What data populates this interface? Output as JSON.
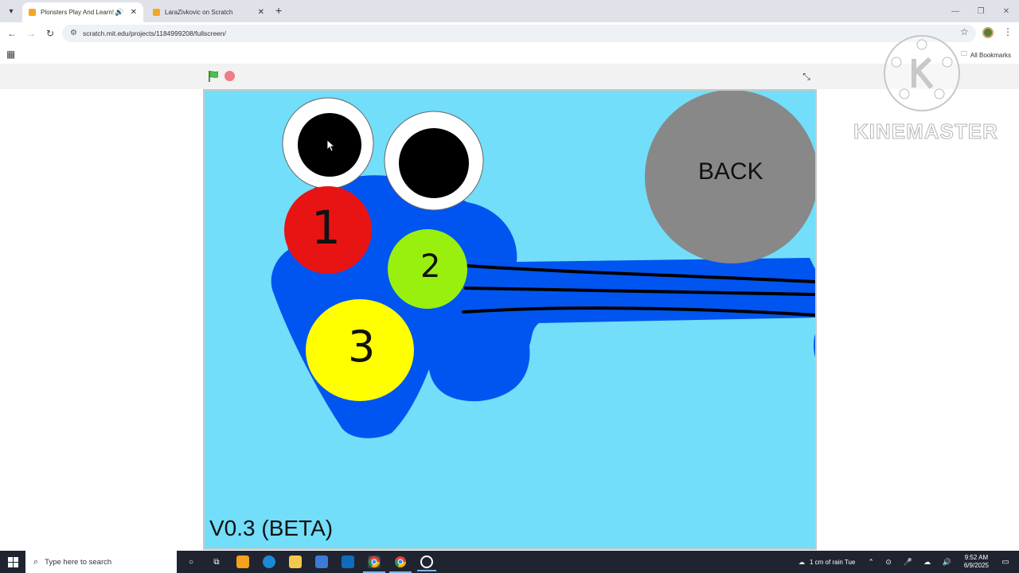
{
  "browser": {
    "tabs": [
      {
        "title": "Plonsters Play And Learn! (B",
        "active": true,
        "audio": "speaker-icon"
      },
      {
        "title": "LaraZivkovic on Scratch",
        "active": false
      }
    ],
    "url": "scratch.mit.edu/projects/1184999208/fullscreen/",
    "all_bookmarks_label": "All Bookmarks"
  },
  "stage": {
    "background_color": "#72def9",
    "creature_color": "#0055f0",
    "buttons": [
      {
        "label": "1",
        "color": "#e81414"
      },
      {
        "label": "2",
        "color": "#99f00f"
      },
      {
        "label": "3",
        "color": "#ffff00"
      }
    ],
    "back_button": {
      "label": "BACK",
      "color": "#888888"
    },
    "version_label": "V0.3 (BETA)"
  },
  "watermark": {
    "text": "KINEMASTER"
  },
  "taskbar": {
    "search_placeholder": "Type here to search",
    "weather": "1 cm of rain Tue",
    "time": "9:52 AM",
    "date": "6/9/2025"
  }
}
